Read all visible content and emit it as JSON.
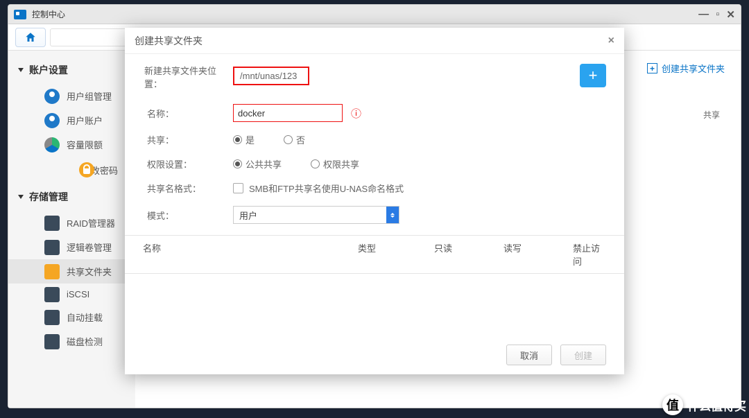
{
  "window": {
    "title": "控制中心"
  },
  "sidebar": {
    "section1": {
      "title": "账户设置"
    },
    "section2": {
      "title": "存储管理"
    },
    "items1": [
      {
        "label": "用户组管理"
      },
      {
        "label": "用户账户"
      },
      {
        "label": "容量限额"
      },
      {
        "label": "修改密码"
      }
    ],
    "items2": [
      {
        "label": "RAID管理器"
      },
      {
        "label": "逻辑卷管理"
      },
      {
        "label": "共享文件夹"
      },
      {
        "label": "iSCSI"
      },
      {
        "label": "自动挂载"
      },
      {
        "label": "磁盘检测"
      }
    ]
  },
  "main": {
    "create_btn": "创建共享文件夹",
    "hint_partial": "共享"
  },
  "modal": {
    "title": "创建共享文件夹",
    "path_label": "新建共享文件夹位置：",
    "path_value": "/mnt/unas/123",
    "name_label": "名称：",
    "name_value": "docker",
    "share_label": "共享：",
    "share_yes": "是",
    "share_no": "否",
    "perm_label": "权限设置：",
    "perm_public": "公共共享",
    "perm_restrict": "权限共享",
    "fmt_label": "共享名格式：",
    "fmt_text": "SMB和FTP共享名使用U-NAS命名格式",
    "mode_label": "模式：",
    "mode_value": "用户",
    "table": {
      "c1": "名称",
      "c2": "类型",
      "c3": "只读",
      "c4": "读写",
      "c5": "禁止访问"
    },
    "cancel": "取消",
    "create": "创建"
  },
  "watermark": "什么值得买"
}
